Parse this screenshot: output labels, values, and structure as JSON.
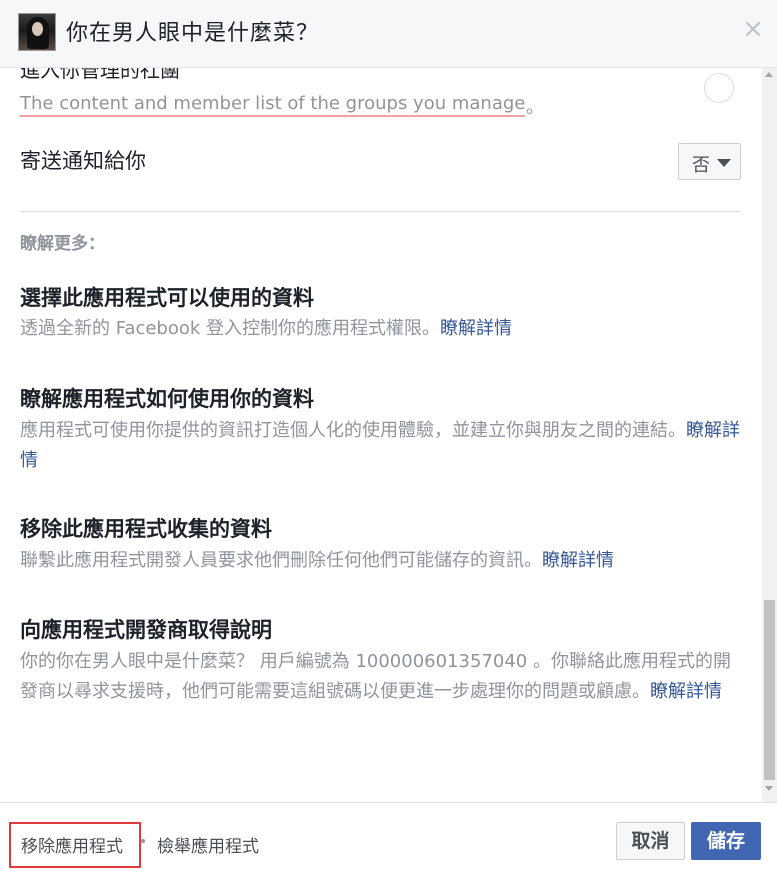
{
  "header": {
    "title": "你在男人眼中是什麼菜？",
    "close_symbol": "×"
  },
  "permission": {
    "title_partial": "進入你管理的社團",
    "description": "The content and member list of the groups you manage",
    "description_suffix": "。"
  },
  "notification": {
    "label": "寄送通知給你",
    "select_value": "否"
  },
  "learn_more": {
    "header": "瞭解更多：",
    "sections": [
      {
        "title": "選擇此應用程式可以使用的資料",
        "body": "透過全新的 Facebook 登入控制你的應用程式權限。",
        "link": "瞭解詳情"
      },
      {
        "title": "瞭解應用程式如何使用你的資料",
        "body": "應用程式可使用你提供的資訊打造個人化的使用體驗，並建立你與朋友之間的連結。",
        "link": "瞭解詳情"
      },
      {
        "title": "移除此應用程式收集的資料",
        "body": "聯繫此應用程式開發人員要求他們刪除任何他們可能儲存的資訊。",
        "link": "瞭解詳情"
      },
      {
        "title": "向應用程式開發商取得說明",
        "body": "你的你在男人眼中是什麼菜？ 用戶編號為 100000601357040 。你聯絡此應用程式的開發商以尋求支援時，他們可能需要這組號碼以便更進一步處理你的問題或顧慮。",
        "link": "瞭解詳情"
      }
    ]
  },
  "footer": {
    "remove_app": "移除應用程式",
    "report_app": "檢舉應用程式",
    "cancel": "取消",
    "save": "儲存"
  },
  "colors": {
    "link": "#365899",
    "primary_button": "#4267b2",
    "highlight_border": "#e0393e"
  }
}
